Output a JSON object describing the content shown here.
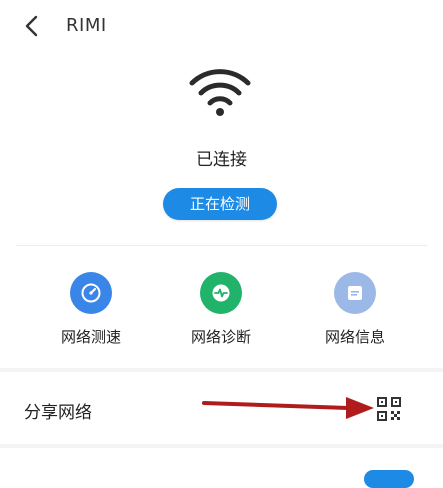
{
  "header": {
    "title": "RIMI",
    "back_icon": "chevron-left-icon"
  },
  "connection": {
    "icon": "wifi-icon",
    "status": "已连接",
    "detect_button": "正在检测"
  },
  "tools": [
    {
      "label": "网络测速",
      "icon": "speedometer-icon",
      "color": "#3a86e8"
    },
    {
      "label": "网络诊断",
      "icon": "heartbeat-icon",
      "color": "#22b36b"
    },
    {
      "label": "网络信息",
      "icon": "document-icon",
      "color": "#9bb8e6"
    }
  ],
  "share": {
    "label": "分享网络",
    "icon": "qr-code-icon",
    "arrow_color": "#b01c1c"
  },
  "colors": {
    "accent": "#1d8be6"
  }
}
